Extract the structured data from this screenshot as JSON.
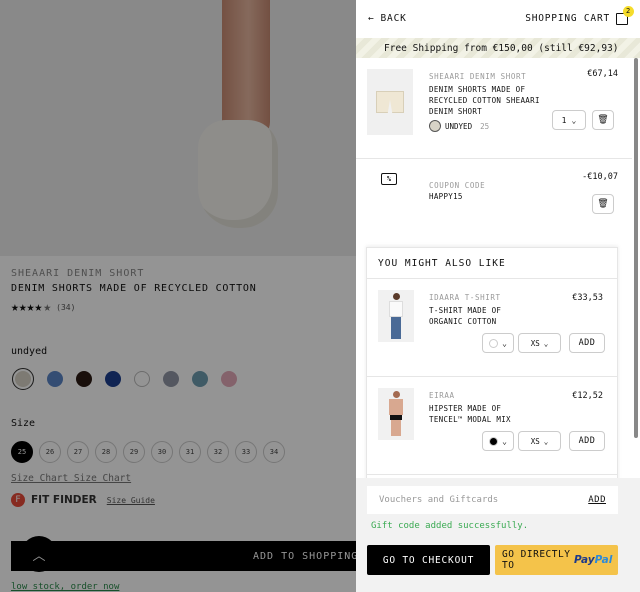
{
  "product": {
    "brand": "SHEAARI DENIM SHORT",
    "title": "DENIM SHORTS MADE OF RECYCLED COTTON",
    "rating_count": "(34)",
    "color_label": "undyed",
    "swatches": [
      "#d7d3c7",
      "#5a85c7",
      "#2b1a14",
      "#1d3f8f",
      "#ffffff",
      "#9297a6",
      "#6e9db0",
      "#e4a9b8"
    ],
    "size_label": "Size",
    "sizes": [
      "25",
      "26",
      "27",
      "28",
      "29",
      "30",
      "31",
      "32",
      "33",
      "34"
    ],
    "size_chart": "Size Chart Size Chart",
    "fit_finder": "FIT FINDER",
    "size_guide": "Size Guide",
    "add_button": "ADD TO SHOPPING C",
    "low_stock": "low stock, order now"
  },
  "cart": {
    "back_label": "BACK",
    "title": "SHOPPING CART",
    "badge_count": "2",
    "shipping_text": "Free Shipping from €150,00 (still €92,93)",
    "item": {
      "brand": "SHEAARI DENIM SHORT",
      "name": "DENIM SHORTS MADE OF RECYCLED COTTON SHEAARI DENIM SHORT",
      "variant": "UNDYED",
      "size": "25",
      "price": "€67,14",
      "qty": "1"
    },
    "coupon": {
      "label": "COUPON CODE",
      "code": "HAPPY15",
      "amount": "-€10,07"
    },
    "reco": {
      "title": "YOU MIGHT ALSO LIKE",
      "items": [
        {
          "brand": "IDAARA T-SHIRT",
          "name": "T-SHIRT MADE OF ORGANIC COTTON",
          "price": "€33,53",
          "size": "XS",
          "add": "ADD",
          "dot_color": "#ffffff"
        },
        {
          "brand": "EIRAA",
          "name": "HIPSTER MADE OF TENCEL™ MODAL MIX",
          "price": "€12,52",
          "size": "XS",
          "add": "ADD",
          "dot_color": "#000000"
        }
      ]
    },
    "voucher_placeholder": "Vouchers and Giftcards",
    "voucher_add": "ADD",
    "success_msg": "Gift code added successfully.",
    "checkout_label": "GO TO CHECKOUT",
    "paypal_label": "GO DIRECTLY TO",
    "paypal_logo_a": "Pay",
    "paypal_logo_b": "Pal"
  }
}
